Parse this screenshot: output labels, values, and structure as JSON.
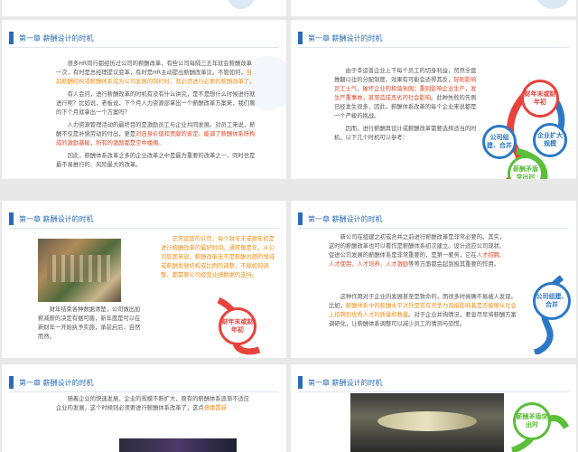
{
  "header_title": "第一章 薪酬设计的时机",
  "slide3": {
    "paragraphs": [
      "很多HR同行都经历过公司的薪酬改革，有些公司每隔三五年就会薪酬改革一次，有时是总经理提议变革，有时是HR主动提出薪酬改革议。不管如何，",
      "有人会问，进行薪酬改革的时机有没有什么讲究，是不是想什么时候进行就进行呢？比如说，老板说，下个月人力资源部拿出一个薪酬改革方案来，我们离的下个月就拿出一个方案吗？",
      "人力资源管理活动的最终目的是激励员工与企业共同发展。对员工来说，薪酬不仅是补偿劳动的付出，更是",
      "因此，薪酬体系改革之多的企业改革之中是最为重要的改革之一，同时也是最不易推行的、风险最大的改革。"
    ],
    "hl1": "当前薪酬结构或薪酬体系成为公司发展的制约时，就必须进行必要的薪酬改革了。",
    "hl2": "对自身价值和贡献的肯定。能调了薪酬体系所构成的激励基础，所有的激励都是空中楼阁。"
  },
  "slide4": {
    "para1a": "由于幸运普企业上下每个员工的切身利益，贸然全盘推翻以往的分配制度，效果有可能会适得其反，",
    "para1b": "轻则影响员工士气，破坏企业的和谐氛围；重则影响企业生产，发生严重事故，甚至造成恶劣的社会影响",
    "para1c": "。此种失败的先例已经发生很多，因此，薪酬体系改革的每个企业来说都是一个严峻的挑战。",
    "para2": "因而，进行薪酬再设计或薪酬改革需要选择适当的时机，以下几个时机可以参考：",
    "bubbles": [
      "财年末或财年初",
      "企业扩大规模",
      "公司组建、合并",
      "薪酬矛盾突出时"
    ]
  },
  "slide5": {
    "quote": "正常运营的公司，每个财年末或财年初是进行薪酬改革的最好时间。通常像是年，从公司层面来说，薪酬改革无不是薪酬总额的增减或薪酬发放结构或比例的调整，不能如何调整，都需要公司经营业绩数据的支持。",
    "caption": "财年结束各种数据清楚，公司做出加薪减薪的决定有据可循，新年度是可以在新财年一开始执予实施，承前启后，自然而然。",
    "bubble": "财年末或财年初"
  },
  "slide6": {
    "para1": "新公司在组建之初或合并之前进行薪酬改革是非常必要的。其实，这时的薪酬改革也可以看作是薪酬体系初次建立。设计适应公司现状、促进公司发展的薪酬体系是非常重要的，是第一要务，它在",
    "para1hl": "人才招聘、人才使用、人才培养、人才激励",
    "para1tail": "等等方面都会起到极其重要的作用。",
    "para2": "这种作用对于企业的发展甚至是致命的，而很多时候确不易被人发现。比如，",
    "para2hl": "薪酬体系中的薪酬水平对外是否有竞争力直接影响着是否能够从社会上招聘到优秀人才的质量和数量",
    "para2tail": "。对于企业并购情况，要息尽早将薪酬方案调研化，让薪酬体系调整可以减少员工的猜测与恐慌。",
    "bubble": "公司组建、合并"
  },
  "slide7": {
    "para": "随着企业的快速发展，企业的规模不断扩大，原有的薪酬体系逐渐不适应企业的发展，这个时候则必须要进行薪酬体系改革了，这点",
    "hl": "毋庸置疑"
  },
  "slide8": {
    "bubble": "薪酬矛盾突出时"
  }
}
